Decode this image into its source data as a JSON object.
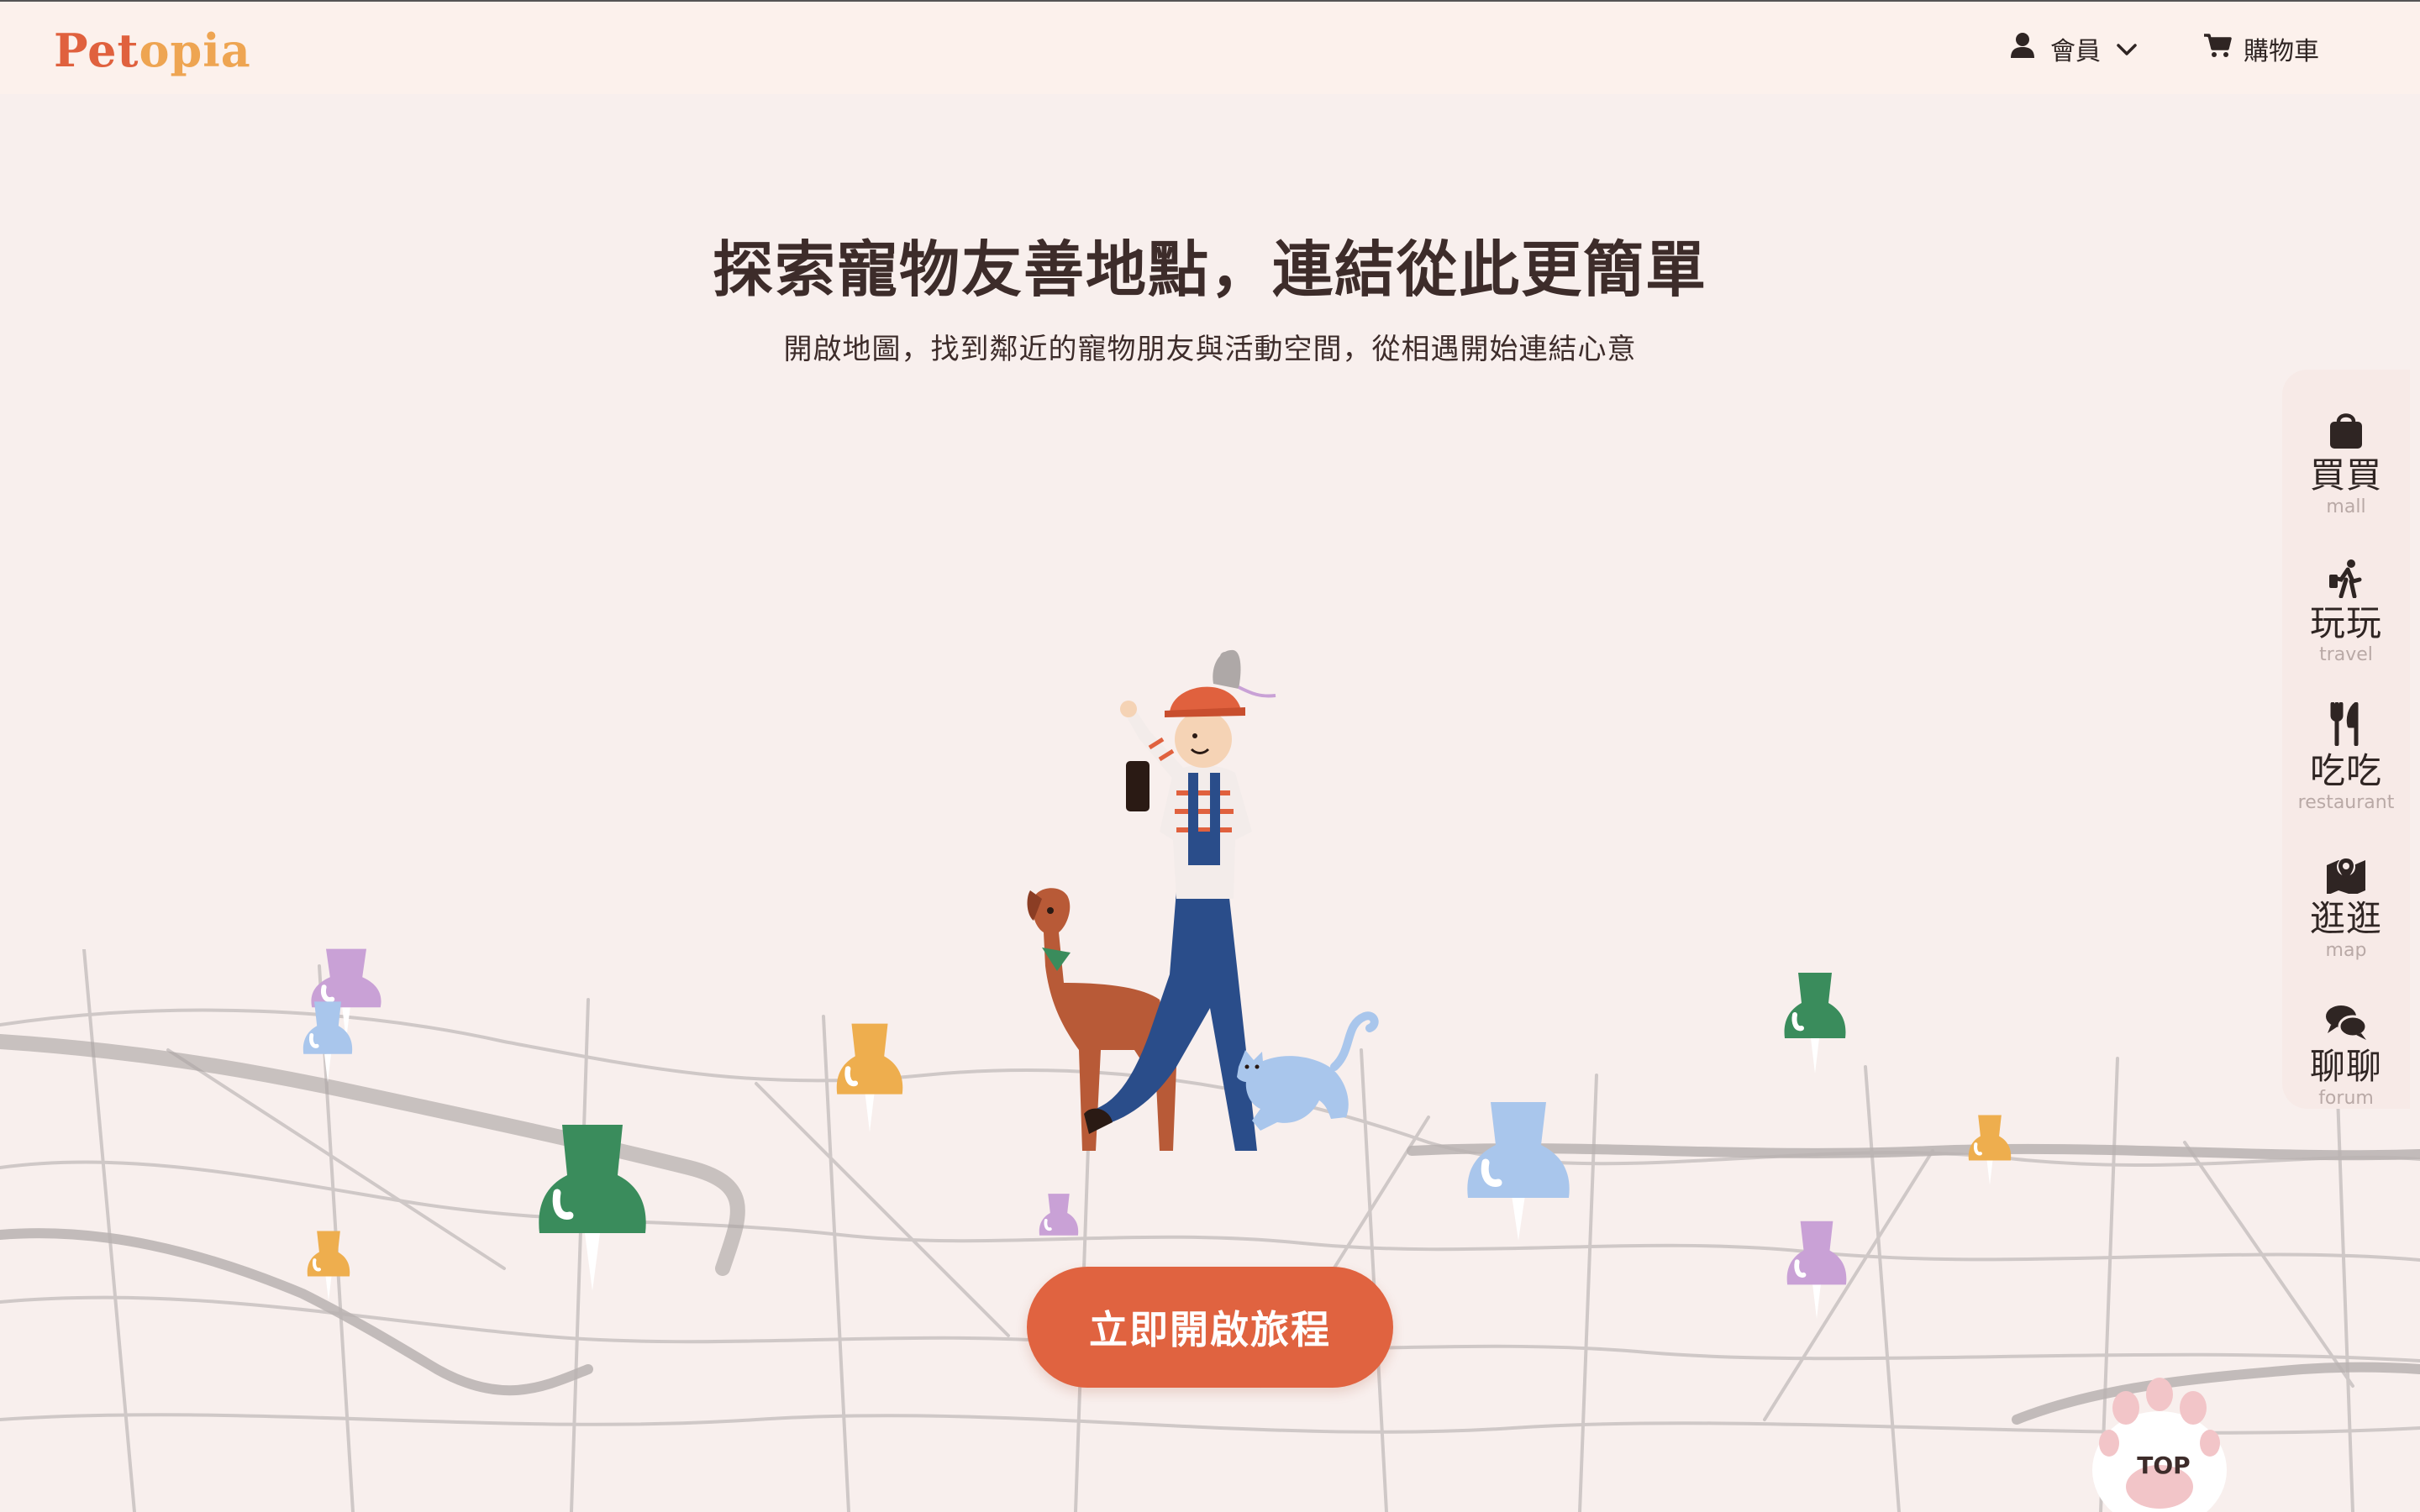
{
  "header": {
    "logo_part1": "Pet",
    "logo_part2": "opia",
    "member_label": "會員",
    "cart_label": "購物車"
  },
  "hero": {
    "title": "探索寵物友善地點，連結從此更簡單",
    "subtitle": "開啟地圖，找到鄰近的寵物朋友與活動空間，從相遇開始連結心意",
    "cta_label": "立即開啟旅程"
  },
  "side_nav": {
    "items": [
      {
        "label": "買買",
        "en": "mall",
        "icon": "shopping-bag-icon"
      },
      {
        "label": "玩玩",
        "en": "travel",
        "icon": "hiking-icon"
      },
      {
        "label": "吃吃",
        "en": "restaurant",
        "icon": "utensils-icon"
      },
      {
        "label": "逛逛",
        "en": "map",
        "icon": "map-marker-icon"
      },
      {
        "label": "聊聊",
        "en": "forum",
        "icon": "chat-bubbles-icon"
      }
    ]
  },
  "top_button": {
    "label": "TOP"
  },
  "colors": {
    "accent": "#e06340",
    "logo_orange": "#e0613e",
    "logo_yellow": "#eea552",
    "background": "#f8efed",
    "pin_green": "#3a8c5c",
    "pin_blue": "#a9c6ec",
    "pin_yellow": "#eeae4e",
    "pin_purple": "#c9a1d6"
  }
}
